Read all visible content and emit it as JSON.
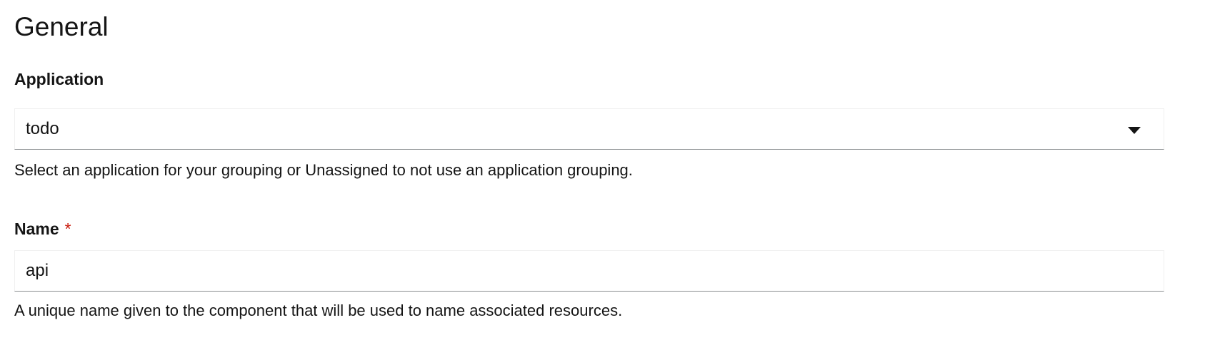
{
  "section": {
    "title": "General"
  },
  "application_field": {
    "label": "Application",
    "selected_value": "todo",
    "helper_text": "Select an application for your grouping or Unassigned to not use an application grouping."
  },
  "name_field": {
    "label": "Name",
    "required_marker": "*",
    "value": "api",
    "helper_text": "A unique name given to the component that will be used to name associated resources."
  },
  "icons": {
    "dropdown": "caret-down-icon"
  },
  "colors": {
    "text": "#151515",
    "required": "#c9190b",
    "field_border_bottom": "#8a8d90",
    "field_border": "#f0f0f0"
  }
}
